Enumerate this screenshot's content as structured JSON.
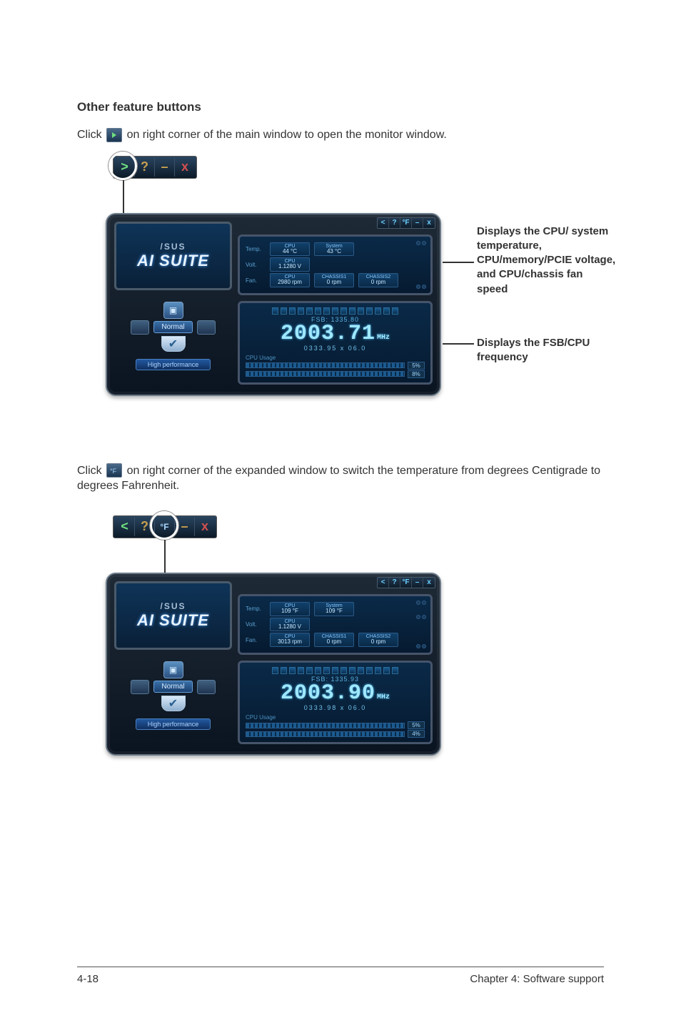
{
  "heading": "Other feature buttons",
  "para1a": "Click ",
  "para1b": " on right corner of the main window to open the monitor window.",
  "para2a": "Click ",
  "para2b": " on right corner of the expanded window to switch the temperature from degrees Centigrade to degrees Fahrenheit.",
  "annot1": "Displays the CPU/ system temperature, CPU/memory/PCIE voltage, and CPU/chassis fan speed",
  "annot2": "Displays the FSB/CPU frequency",
  "top_strip": {
    "expand": ">",
    "help": "?",
    "min": "–",
    "close": "x"
  },
  "mini_strip": {
    "collapse": "<",
    "help": "?",
    "unit": "°F",
    "min": "–",
    "close": "x"
  },
  "brand": {
    "asus": "/SUS",
    "suite": "AI SUITE"
  },
  "mode": {
    "badge": "Normal",
    "hp": "High performance"
  },
  "window1": {
    "temp_label": "Temp.",
    "volt_label": "Volt.",
    "fan_label": "Fan.",
    "temp_cpu": {
      "t": "CPU",
      "v": "44 °C"
    },
    "temp_sys": {
      "t": "System",
      "v": "43 °C"
    },
    "volt_cpu": {
      "t": "CPU",
      "v": "1.1280 V"
    },
    "fan_cpu": {
      "t": "CPU",
      "v": "2980 rpm"
    },
    "fan_ch1": {
      "t": "CHASSIS1",
      "v": "0 rpm"
    },
    "fan_ch2": {
      "t": "CHASSIS2",
      "v": "0 rpm"
    },
    "fsb": "FSB: 1335.80",
    "freq": "2003.71",
    "mhz": "MHz",
    "mult": "0333.95 x 06.0",
    "cpu_usage_lbl": "CPU Usage",
    "u1": "5%",
    "u2": "8%"
  },
  "window2": {
    "temp_cpu": {
      "t": "CPU",
      "v": "109 °F"
    },
    "temp_sys": {
      "t": "System",
      "v": "109 °F"
    },
    "volt_cpu": {
      "t": "CPU",
      "v": "1.1280 V"
    },
    "fan_cpu": {
      "t": "CPU",
      "v": "3013 rpm"
    },
    "fan_ch1": {
      "t": "CHASSIS1",
      "v": "0 rpm"
    },
    "fan_ch2": {
      "t": "CHASSIS2",
      "v": "0 rpm"
    },
    "fsb": "FSB: 1335.93",
    "freq": "2003.90",
    "mult": "0333.98 x 06.0",
    "u1": "5%",
    "u2": "4%"
  },
  "footer": {
    "left": "4-18",
    "right": "Chapter 4: Software support"
  }
}
